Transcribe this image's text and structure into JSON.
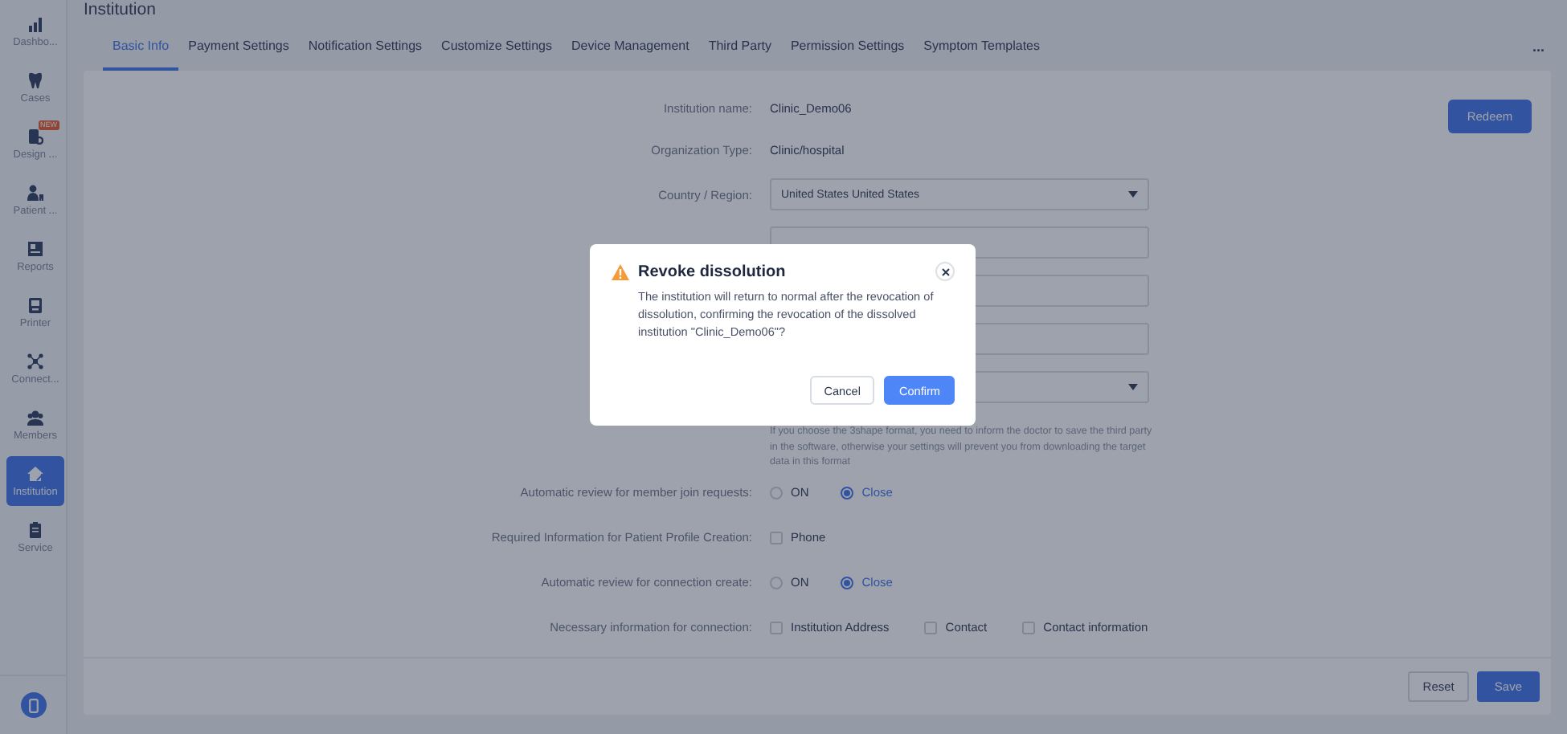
{
  "sidebar": {
    "items": [
      {
        "label": "Dashbo...",
        "selected": false
      },
      {
        "label": "Cases",
        "selected": false
      },
      {
        "label": "Design ...",
        "selected": false,
        "badge": "NEW"
      },
      {
        "label": "Patient ...",
        "selected": false
      },
      {
        "label": "Reports",
        "selected": false
      },
      {
        "label": "Printer",
        "selected": false
      },
      {
        "label": "Connect...",
        "selected": false
      },
      {
        "label": "Members",
        "selected": false
      },
      {
        "label": "Institution",
        "selected": true
      },
      {
        "label": "Service",
        "selected": false
      }
    ]
  },
  "header": {
    "title": "Institution",
    "more": "..."
  },
  "tabs": [
    {
      "label": "Basic Info",
      "selected": true
    },
    {
      "label": "Payment Settings",
      "selected": false
    },
    {
      "label": "Notification Settings",
      "selected": false
    },
    {
      "label": "Customize Settings",
      "selected": false
    },
    {
      "label": "Device Management",
      "selected": false
    },
    {
      "label": "Third Party",
      "selected": false
    },
    {
      "label": "Permission Settings",
      "selected": false
    },
    {
      "label": "Symptom Templates",
      "selected": false
    }
  ],
  "form": {
    "redeem": "Redeem",
    "rows": [
      {
        "kind": "text",
        "label": "Institution name:",
        "value": "Clinic_Demo06"
      },
      {
        "kind": "text",
        "label": "Organization Type:",
        "value": "Clinic/hospital"
      },
      {
        "kind": "select",
        "label": "Country / Region:",
        "value": "United States United States"
      },
      {
        "kind": "input"
      },
      {
        "kind": "input"
      },
      {
        "kind": "input"
      },
      {
        "kind": "select"
      },
      {
        "kind": "note",
        "text": "If you choose the 3shape format, you need to inform the doctor to save the third party in the software, otherwise your settings will prevent you from downloading the target data in this format"
      },
      {
        "kind": "radio",
        "label": "Automatic review for member join requests:",
        "options": [
          {
            "label": "ON",
            "selected": false
          },
          {
            "label": "Close",
            "selected": true
          }
        ]
      },
      {
        "kind": "checkbox",
        "label": "Required Information for Patient Profile Creation:",
        "options": [
          {
            "label": "Phone",
            "checked": false
          }
        ]
      },
      {
        "kind": "radio",
        "label": "Automatic review for connection create:",
        "options": [
          {
            "label": "ON",
            "selected": false
          },
          {
            "label": "Close",
            "selected": true
          }
        ]
      },
      {
        "kind": "checkbox",
        "label": "Necessary information for connection:",
        "options": [
          {
            "label": "Institution Address",
            "checked": false
          },
          {
            "label": "Contact",
            "checked": false
          },
          {
            "label": "Contact information",
            "checked": false
          }
        ]
      }
    ]
  },
  "footer": {
    "buttons": [
      "Reset",
      "Save"
    ]
  },
  "dialog": {
    "title": "Revoke dissolution",
    "message": "The institution will return to normal after the revocation of dissolution, confirming the revocation of the dissolved institution \"Clinic_Demo06\"?",
    "buttons": [
      "Cancel",
      "Confirm"
    ]
  }
}
